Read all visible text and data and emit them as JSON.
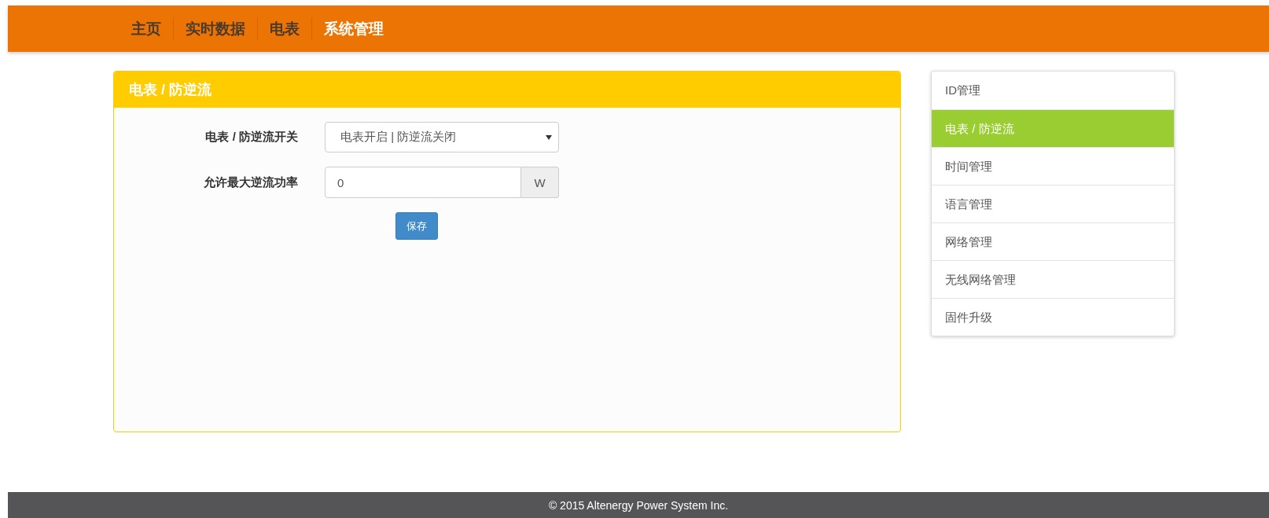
{
  "nav": {
    "items": [
      {
        "label": "主页",
        "selected": false
      },
      {
        "label": "实时数据",
        "selected": false
      },
      {
        "label": "电表",
        "selected": false
      },
      {
        "label": "系统管理",
        "selected": true
      }
    ]
  },
  "panel": {
    "title": "电表 / 防逆流",
    "fields": [
      {
        "kind": "select",
        "label": "电表 / 防逆流开关",
        "value": "电表开启 | 防逆流关闭"
      },
      {
        "kind": "input",
        "label": "允许最大逆流功率",
        "value": "0",
        "unit": "W"
      }
    ],
    "save_button": "保存"
  },
  "sidebar": {
    "items": [
      {
        "label": "ID管理",
        "selected": false
      },
      {
        "label": "电表 / 防逆流",
        "selected": true
      },
      {
        "label": "时间管理",
        "selected": false
      },
      {
        "label": "语言管理",
        "selected": false
      },
      {
        "label": "网络管理",
        "selected": false
      },
      {
        "label": "无线网络管理",
        "selected": false
      },
      {
        "label": "固件升级",
        "selected": false
      }
    ]
  },
  "footer": {
    "text": "© 2015 Altenergy Power System Inc."
  }
}
